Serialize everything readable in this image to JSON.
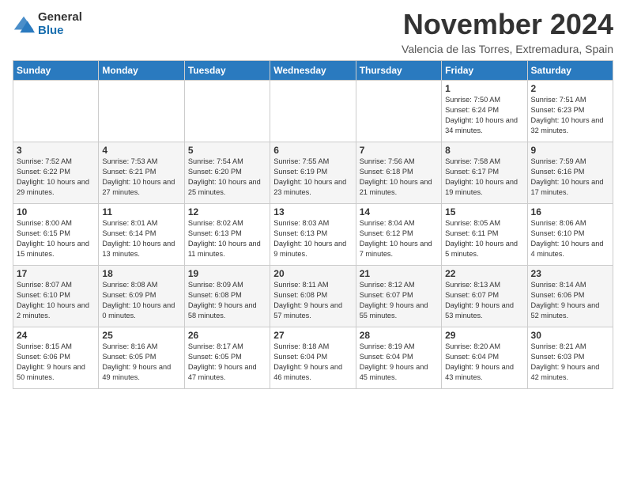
{
  "logo": {
    "line1": "General",
    "line2": "Blue"
  },
  "title": "November 2024",
  "location": "Valencia de las Torres, Extremadura, Spain",
  "days_of_week": [
    "Sunday",
    "Monday",
    "Tuesday",
    "Wednesday",
    "Thursday",
    "Friday",
    "Saturday"
  ],
  "weeks": [
    [
      {
        "day": "",
        "info": ""
      },
      {
        "day": "",
        "info": ""
      },
      {
        "day": "",
        "info": ""
      },
      {
        "day": "",
        "info": ""
      },
      {
        "day": "",
        "info": ""
      },
      {
        "day": "1",
        "info": "Sunrise: 7:50 AM\nSunset: 6:24 PM\nDaylight: 10 hours and 34 minutes."
      },
      {
        "day": "2",
        "info": "Sunrise: 7:51 AM\nSunset: 6:23 PM\nDaylight: 10 hours and 32 minutes."
      }
    ],
    [
      {
        "day": "3",
        "info": "Sunrise: 7:52 AM\nSunset: 6:22 PM\nDaylight: 10 hours and 29 minutes."
      },
      {
        "day": "4",
        "info": "Sunrise: 7:53 AM\nSunset: 6:21 PM\nDaylight: 10 hours and 27 minutes."
      },
      {
        "day": "5",
        "info": "Sunrise: 7:54 AM\nSunset: 6:20 PM\nDaylight: 10 hours and 25 minutes."
      },
      {
        "day": "6",
        "info": "Sunrise: 7:55 AM\nSunset: 6:19 PM\nDaylight: 10 hours and 23 minutes."
      },
      {
        "day": "7",
        "info": "Sunrise: 7:56 AM\nSunset: 6:18 PM\nDaylight: 10 hours and 21 minutes."
      },
      {
        "day": "8",
        "info": "Sunrise: 7:58 AM\nSunset: 6:17 PM\nDaylight: 10 hours and 19 minutes."
      },
      {
        "day": "9",
        "info": "Sunrise: 7:59 AM\nSunset: 6:16 PM\nDaylight: 10 hours and 17 minutes."
      }
    ],
    [
      {
        "day": "10",
        "info": "Sunrise: 8:00 AM\nSunset: 6:15 PM\nDaylight: 10 hours and 15 minutes."
      },
      {
        "day": "11",
        "info": "Sunrise: 8:01 AM\nSunset: 6:14 PM\nDaylight: 10 hours and 13 minutes."
      },
      {
        "day": "12",
        "info": "Sunrise: 8:02 AM\nSunset: 6:13 PM\nDaylight: 10 hours and 11 minutes."
      },
      {
        "day": "13",
        "info": "Sunrise: 8:03 AM\nSunset: 6:13 PM\nDaylight: 10 hours and 9 minutes."
      },
      {
        "day": "14",
        "info": "Sunrise: 8:04 AM\nSunset: 6:12 PM\nDaylight: 10 hours and 7 minutes."
      },
      {
        "day": "15",
        "info": "Sunrise: 8:05 AM\nSunset: 6:11 PM\nDaylight: 10 hours and 5 minutes."
      },
      {
        "day": "16",
        "info": "Sunrise: 8:06 AM\nSunset: 6:10 PM\nDaylight: 10 hours and 4 minutes."
      }
    ],
    [
      {
        "day": "17",
        "info": "Sunrise: 8:07 AM\nSunset: 6:10 PM\nDaylight: 10 hours and 2 minutes."
      },
      {
        "day": "18",
        "info": "Sunrise: 8:08 AM\nSunset: 6:09 PM\nDaylight: 10 hours and 0 minutes."
      },
      {
        "day": "19",
        "info": "Sunrise: 8:09 AM\nSunset: 6:08 PM\nDaylight: 9 hours and 58 minutes."
      },
      {
        "day": "20",
        "info": "Sunrise: 8:11 AM\nSunset: 6:08 PM\nDaylight: 9 hours and 57 minutes."
      },
      {
        "day": "21",
        "info": "Sunrise: 8:12 AM\nSunset: 6:07 PM\nDaylight: 9 hours and 55 minutes."
      },
      {
        "day": "22",
        "info": "Sunrise: 8:13 AM\nSunset: 6:07 PM\nDaylight: 9 hours and 53 minutes."
      },
      {
        "day": "23",
        "info": "Sunrise: 8:14 AM\nSunset: 6:06 PM\nDaylight: 9 hours and 52 minutes."
      }
    ],
    [
      {
        "day": "24",
        "info": "Sunrise: 8:15 AM\nSunset: 6:06 PM\nDaylight: 9 hours and 50 minutes."
      },
      {
        "day": "25",
        "info": "Sunrise: 8:16 AM\nSunset: 6:05 PM\nDaylight: 9 hours and 49 minutes."
      },
      {
        "day": "26",
        "info": "Sunrise: 8:17 AM\nSunset: 6:05 PM\nDaylight: 9 hours and 47 minutes."
      },
      {
        "day": "27",
        "info": "Sunrise: 8:18 AM\nSunset: 6:04 PM\nDaylight: 9 hours and 46 minutes."
      },
      {
        "day": "28",
        "info": "Sunrise: 8:19 AM\nSunset: 6:04 PM\nDaylight: 9 hours and 45 minutes."
      },
      {
        "day": "29",
        "info": "Sunrise: 8:20 AM\nSunset: 6:04 PM\nDaylight: 9 hours and 43 minutes."
      },
      {
        "day": "30",
        "info": "Sunrise: 8:21 AM\nSunset: 6:03 PM\nDaylight: 9 hours and 42 minutes."
      }
    ]
  ]
}
